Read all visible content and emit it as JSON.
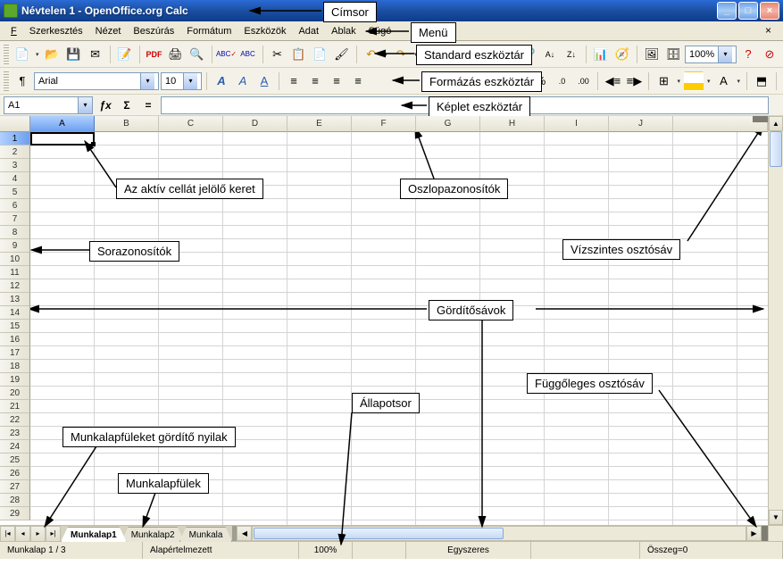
{
  "title": "Névtelen 1 - OpenOffice.org Calc",
  "menu": [
    "Fájl",
    "Szerkesztés",
    "Nézet",
    "Beszúrás",
    "Formátum",
    "Eszközök",
    "Adat",
    "Ablak",
    "Súgó"
  ],
  "standard_toolbar": {
    "zoom": "100%"
  },
  "format_toolbar": {
    "font_name": "Arial",
    "font_size": "10"
  },
  "formula_bar": {
    "cell_ref": "A1",
    "formula": ""
  },
  "columns": [
    "A",
    "B",
    "C",
    "D",
    "E",
    "F",
    "G",
    "H",
    "I",
    "J"
  ],
  "row_count": 29,
  "selected_col": "A",
  "selected_row": 1,
  "sheet_tabs": [
    "Munkalap1",
    "Munkalap2",
    "Munkala"
  ],
  "active_tab": 0,
  "status": {
    "sheet_pos": "Munkalap 1 / 3",
    "style": "Alapértelmezett",
    "zoom": "100%",
    "insert_mode": "Egyszeres",
    "sum": "Összeg=0"
  },
  "annotations": {
    "cimsor": "Címsor",
    "menu": "Menü",
    "standard": "Standard eszköztár",
    "formazas": "Formázás eszköztár",
    "keplet": "Képlet eszköztár",
    "aktiv_cella": "Az aktív cellát jelölő keret",
    "oszlopaz": "Oszlopazonosítók",
    "soraz": "Sorazonosítók",
    "vizszintes": "Vízszintes osztósáv",
    "gorditosav": "Gördítősávok",
    "fuggoleges": "Függőleges osztósáv",
    "allapotsor": "Állapotsor",
    "munkalapful_nyil": "Munkalapfüleket gördítő nyilak",
    "munkalapful": "Munkalapfülek"
  }
}
